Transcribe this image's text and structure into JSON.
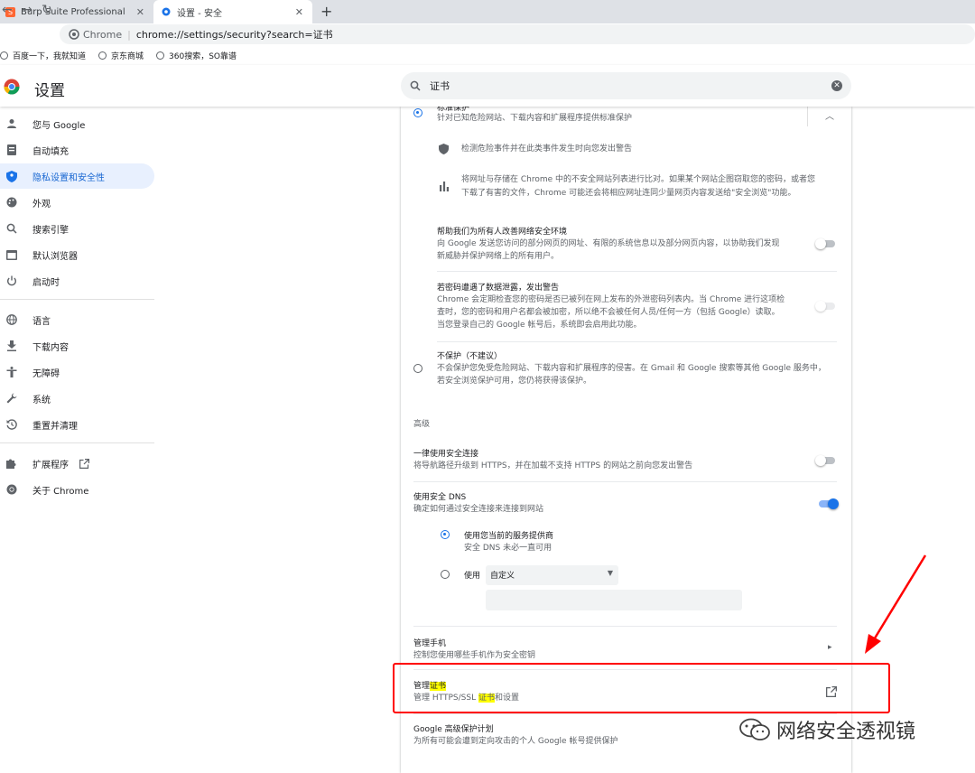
{
  "tabs": [
    {
      "title": "Burp Suite Professional",
      "icon": "burp-icon"
    },
    {
      "title": "设置 - 安全",
      "icon": "gear-icon"
    }
  ],
  "toolbar": {
    "site_label": "Chrome",
    "separator": "|",
    "url": "chrome://settings/security?search=证书"
  },
  "bookmarks": [
    "百度一下，我就知道",
    "京东商城",
    "360搜索，SO靠谱"
  ],
  "header": {
    "title": "设置",
    "search_value": "证书"
  },
  "sidebar": {
    "items": [
      {
        "label": "您与 Google",
        "icon": "person-icon"
      },
      {
        "label": "自动填充",
        "icon": "autofill-icon"
      },
      {
        "label": "隐私设置和安全性",
        "icon": "shield-icon",
        "active": true
      },
      {
        "label": "外观",
        "icon": "palette-icon"
      },
      {
        "label": "搜索引擎",
        "icon": "search-icon"
      },
      {
        "label": "默认浏览器",
        "icon": "browser-icon"
      },
      {
        "label": "启动时",
        "icon": "power-icon"
      },
      {
        "label": "语言",
        "icon": "globe-icon"
      },
      {
        "label": "下载内容",
        "icon": "download-icon"
      },
      {
        "label": "无障碍",
        "icon": "accessibility-icon"
      },
      {
        "label": "系统",
        "icon": "wrench-icon"
      },
      {
        "label": "重置并清理",
        "icon": "reset-icon"
      },
      {
        "label": "扩展程序",
        "icon": "puzzle-icon"
      },
      {
        "label": "关于 Chrome",
        "icon": "chrome-icon"
      }
    ]
  },
  "main": {
    "standard": {
      "title": "标准保护",
      "desc": "针对已知危险网站、下载内容和扩展程序提供标准保护",
      "selected": true
    },
    "detail1": "检测危险事件并在此类事件发生时向您发出警告",
    "detail2_line1": "将网址与存储在 Chrome 中的不安全网站列表进行比对。如果某个网站企图窃取您的密码，或者您",
    "detail2_line2": "下载了有害的文件，Chrome 可能还会将相应网址连同少量网页内容发送给\"安全浏览\"功能。",
    "help": {
      "title": "帮助我们为所有人改善网络安全环境",
      "line1": "向 Google 发送您访问的部分网页的网址、有限的系统信息以及部分网页内容，以协助我们发现",
      "line2": "新威胁并保护网络上的所有用户。",
      "on": false
    },
    "leak": {
      "title": "若密码遭遇了数据泄露，发出警告",
      "line1": "Chrome 会定期检查您的密码是否已被列在网上发布的外泄密码列表内。当 Chrome 进行这项检",
      "line2": "查时，您的密码和用户名都会被加密，所以绝不会被任何人员/任何一方（包括 Google）读取。",
      "line3": "当您登录自己的 Google 帐号后，系统即会启用此功能。",
      "on": false
    },
    "noprotect": {
      "title": "不保护（不建议）",
      "line1": "不会保护您免受危险网站、下载内容和扩展程序的侵害。在 Gmail 和 Google 搜索等其他 Google 服务中，",
      "line2": "若安全浏览保护可用，您仍将获得该保护。",
      "selected": false
    },
    "advanced_label": "高级",
    "https": {
      "title": "一律使用安全连接",
      "desc": "将导航路径升级到 HTTPS，并在加载不支持 HTTPS 的网站之前向您发出警告",
      "on": false
    },
    "dns": {
      "title": "使用安全 DNS",
      "desc": "确定如何通过安全连接来连接到网站",
      "on": true,
      "opt1_title": "使用您当前的服务提供商",
      "opt1_desc": "安全 DNS 未必一直可用",
      "opt2_label": "使用",
      "opt2_select": "自定义",
      "opt2_input": ""
    },
    "phones": {
      "title": "管理手机",
      "desc": "控制您使用哪些手机作为安全密钥"
    },
    "certs": {
      "title_pre": "管理",
      "title_hl": "证书",
      "desc_pre": "管理 HTTPS/SSL ",
      "desc_hl": "证书",
      "desc_post": "和设置"
    },
    "gapp": {
      "title": "Google 高级保护计划",
      "desc": "为所有可能会遭到定向攻击的个人 Google 帐号提供保护"
    }
  },
  "watermark": "网络安全透视镜",
  "colors": {
    "accent": "#1a73e8",
    "highlight": "#ffff00",
    "annotation": "#ff0000"
  }
}
